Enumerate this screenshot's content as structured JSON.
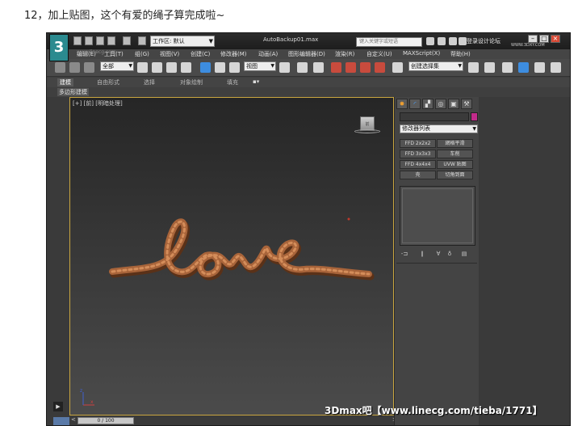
{
  "caption": "12，加上贴图，这个有爱的绳子算完成啦~",
  "titlebar": {
    "logo": "3",
    "workspace_label": "工作区: 默认",
    "file_title": "AutoBackup01.max",
    "search_placeholder": "键入关键字或短语",
    "help_label": "登录设计论坛",
    "watermark": "WWW.3DXY.COM"
  },
  "menu": {
    "items": [
      "编辑(E)",
      "工具(T)",
      "组(G)",
      "视图(V)",
      "创建(C)",
      "修改器(M)",
      "动画(A)",
      "图形编辑器(D)",
      "渲染(R)",
      "自定义(U)",
      "MAXScript(X)",
      "帮助(H)"
    ]
  },
  "watermark_url": "www.linecg.com",
  "toolbar": {
    "select_filter": "全部",
    "ref_coord": "视图",
    "named_selection": "创建选择集"
  },
  "ribbon": {
    "tabs": [
      "建模",
      "自由形式",
      "选择",
      "对象绘制",
      "填充"
    ],
    "sub_label": "多边形建模"
  },
  "viewport": {
    "label": "[+] [前] [明暗处理]",
    "cube_label": "前",
    "axis_x": "x",
    "axis_z": "z"
  },
  "command_panel": {
    "modifier_list": "修改器列表",
    "buttons": [
      "FFD 2x2x2",
      "網格平滑",
      "FFD 3x3x3",
      "车削",
      "FFD 4x4x4",
      "UVW 贴图",
      "壳",
      "切角到面"
    ]
  },
  "timeline": {
    "value": "0 / 100",
    "left": "<",
    "right": ">"
  },
  "bottom_watermark": "3Dmax吧【www.linecg.com/tieba/1771】",
  "colors": {
    "rope": "#a8643a",
    "viewport_border": "#c9a640",
    "swatch": "#c12b8a"
  }
}
